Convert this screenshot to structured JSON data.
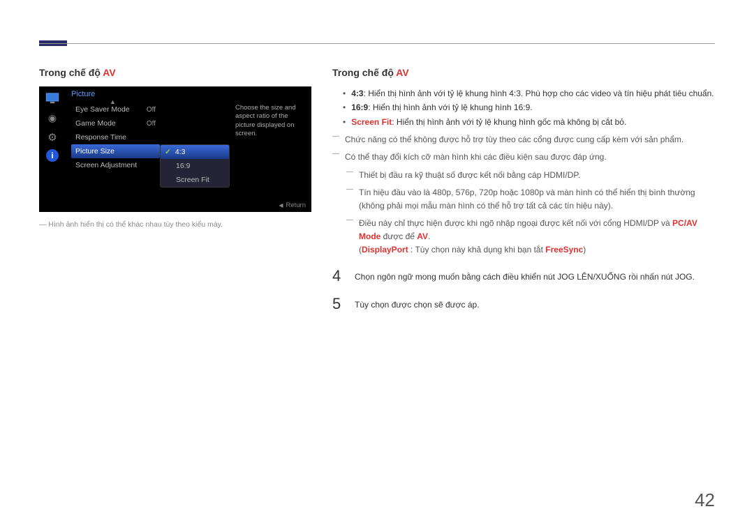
{
  "pageNumber": "42",
  "left": {
    "heading_prefix": "Trong chế độ ",
    "heading_av": "AV",
    "osd": {
      "title": "Picture",
      "menu": [
        {
          "label": "Eye Saver Mode",
          "value": "Off"
        },
        {
          "label": "Game Mode",
          "value": "Off"
        },
        {
          "label": "Response Time",
          "value": ""
        },
        {
          "label": "Picture Size",
          "value": "",
          "selected": true
        },
        {
          "label": "Screen Adjustment",
          "value": ""
        }
      ],
      "options": [
        {
          "label": "4:3",
          "selected": true
        },
        {
          "label": "16:9"
        },
        {
          "label": "Screen Fit"
        }
      ],
      "helpText": "Choose the size and aspect ratio of the picture displayed on screen.",
      "returnLabel": "Return"
    },
    "note": "― Hình ảnh hiển thị có thể khác nhau tùy theo kiểu máy."
  },
  "right": {
    "heading_prefix": "Trong chế độ ",
    "heading_av": "AV",
    "bullets": [
      {
        "bold": "4:3",
        "text": ": Hiển thị hình ảnh với tỷ lệ khung hình 4:3. Phù hợp cho các video và tín hiệu phát tiêu chuẩn."
      },
      {
        "bold": "16:9",
        "text": ": Hiển thị hình ảnh với tỷ lệ khung hình 16:9."
      },
      {
        "boldRed": "Screen Fit",
        "text": ": Hiển thị hình ảnh với tỷ lệ khung hình gốc mà không bị cắt bỏ."
      }
    ],
    "dash1": "Chức năng có thể không được hỗ trợ tùy theo các cổng được cung cấp kèm với sản phẩm.",
    "dash2": "Có thể thay đổi kích cỡ màn hình khi các điều kiện sau được đáp ứng.",
    "sub1": "Thiết bị đầu ra kỹ thuật số được kết nối bằng cáp HDMI/DP.",
    "sub2": "Tín hiệu đầu vào là 480p, 576p, 720p hoặc 1080p và màn hình có thể hiển thị bình thường (không phải mọi mẫu màn hình có thể hỗ trợ tất cả các tín hiệu này).",
    "sub3_a": "Điều này chỉ thực hiện được khi ngõ nhập ngoại được kết nối với cổng HDMI/DP và ",
    "sub3_pcav": "PC/AV Mode",
    "sub3_b": " được để ",
    "sub3_av": "AV",
    "sub3_c": ".",
    "sub3_paren_a": "(",
    "sub3_dp": "DisplayPort",
    "sub3_paren_b": " : Tùy chọn này khả dụng khi bạn tắt ",
    "sub3_fs": "FreeSync",
    "sub3_paren_c": ")",
    "step4_num": "4",
    "step4_text": "Chọn ngôn ngữ mong muốn bằng cách điều khiển nút JOG LÊN/XUỐNG rồi nhấn nút JOG.",
    "step5_num": "5",
    "step5_text": "Tùy chọn được chọn sẽ được áp."
  }
}
